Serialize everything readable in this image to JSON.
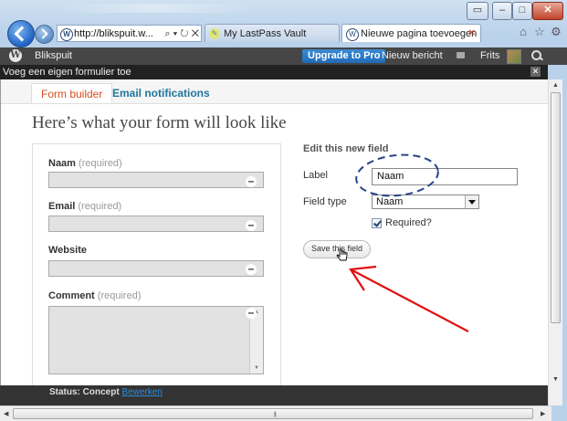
{
  "browser": {
    "address": "http://blikspuit.w...",
    "tabs": [
      {
        "label": "My LastPass Vault"
      },
      {
        "label": "Nieuwe pagina toevoegen ‹..."
      }
    ]
  },
  "adminbar": {
    "site": "Blikspuit",
    "upgrade": "Upgrade to Pro",
    "new_post": "Nieuw bericht",
    "user": "Frits"
  },
  "dialog": {
    "title": "Voeg een eigen formulier toe",
    "tabs": {
      "form_builder": "Form builder",
      "email": "Email notifications"
    },
    "heading": "Here’s what your form will look like",
    "fields": [
      {
        "label": "Naam",
        "req": "(required)"
      },
      {
        "label": "Email",
        "req": "(required)"
      },
      {
        "label": "Website",
        "req": ""
      },
      {
        "label": "Comment",
        "req": "(required)"
      }
    ],
    "edit": {
      "heading": "Edit this new field",
      "label_caption": "Label",
      "label_value": "Naam",
      "type_caption": "Field type",
      "type_value": "Naam",
      "required_label": "Required?",
      "required_checked": true,
      "save": "Save this field"
    }
  },
  "status": {
    "text": "Status: Concept",
    "link": "Bewerken"
  }
}
